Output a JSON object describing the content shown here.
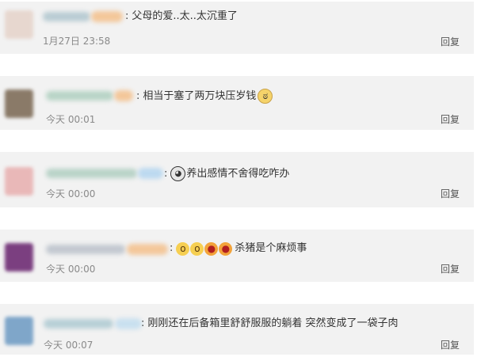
{
  "comments": [
    {
      "text": "父母的爱..太..太沉重了",
      "time": "1月27日 23:58",
      "reply": "回复",
      "avatar_color": "#e7d7cf",
      "emojis_after": []
    },
    {
      "text": "相当于塞了两万块压岁钱",
      "time": "今天 00:01",
      "reply": "回复",
      "avatar_color": "#8a7a68",
      "emojis_after": [
        "cat-face-emoji"
      ]
    },
    {
      "text": "养出感情不舍得吃咋办",
      "time": "今天 00:00",
      "reply": "回复",
      "avatar_color": "#e9b8b8",
      "emojis_before": [
        "panda-crying-emoji"
      ]
    },
    {
      "text": "杀猪是个麻烦事",
      "time": "今天 00:00",
      "reply": "回复",
      "avatar_color": "#7b3f80",
      "emojis_before": [
        "shocked-face-emoji",
        "shocked-face-emoji",
        "screaming-face-emoji",
        "screaming-face-emoji"
      ]
    },
    {
      "text": "刚刚还在后备箱里舒舒服服的躺着  突然变成了一袋子肉",
      "time": "今天 00:07",
      "reply": "回复",
      "avatar_color": "#7fa6c9",
      "emojis_after": []
    }
  ],
  "separator": ":"
}
